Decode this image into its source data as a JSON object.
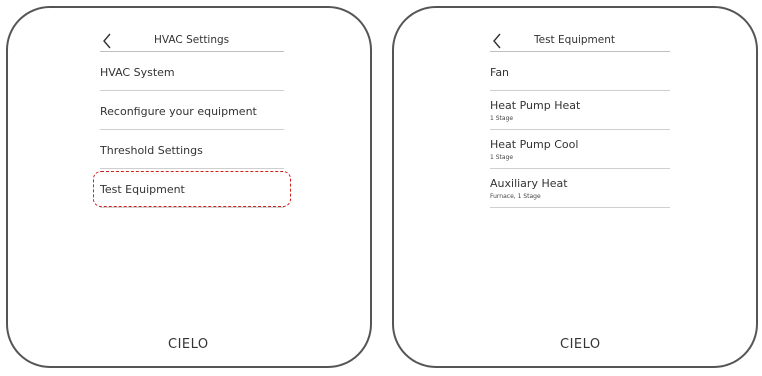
{
  "left": {
    "title": "HVAC Settings",
    "items": [
      {
        "label": "HVAC System"
      },
      {
        "label": "Reconfigure your equipment"
      },
      {
        "label": "Threshold Settings"
      },
      {
        "label": "Test Equipment"
      }
    ],
    "logo": "CIELO"
  },
  "right": {
    "title": "Test Equipment",
    "items": [
      {
        "label": "Fan",
        "sub": ""
      },
      {
        "label": "Heat Pump Heat",
        "sub": "1 Stage"
      },
      {
        "label": "Heat Pump Cool",
        "sub": "1 Stage"
      },
      {
        "label": "Auxiliary Heat",
        "sub": "Furnace, 1 Stage"
      }
    ],
    "logo": "CIELO"
  },
  "colors": {
    "highlight": "#d01f1f",
    "border": "#555555"
  },
  "icons": {
    "back": "chevron-left-icon"
  }
}
